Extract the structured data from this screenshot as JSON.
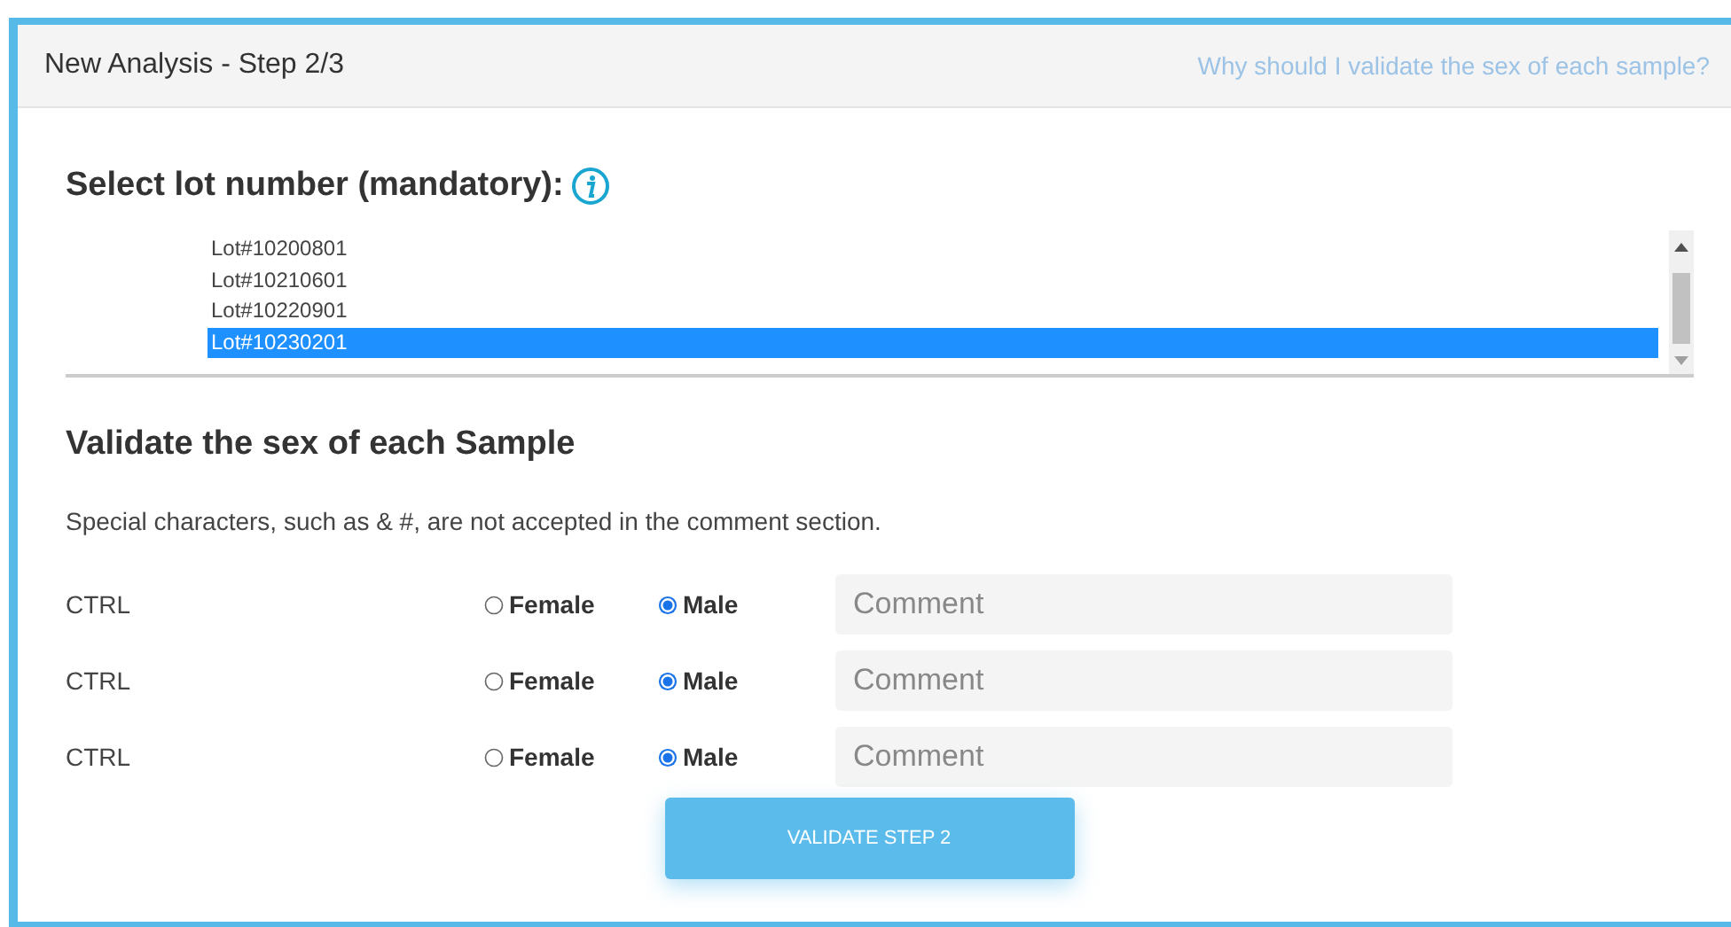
{
  "panel": {
    "title": "New Analysis - Step 2/3",
    "help_link": "Why should I validate the sex of each sample?"
  },
  "lot_section": {
    "heading": "Select lot number (mandatory):",
    "lots": [
      {
        "label": "Lot#10200801",
        "selected": false
      },
      {
        "label": "Lot#10210601",
        "selected": false
      },
      {
        "label": "Lot#10220901",
        "selected": false
      },
      {
        "label": "Lot#10230201",
        "selected": true
      }
    ]
  },
  "sex_section": {
    "heading": "Validate the sex of each Sample",
    "note": "Special characters, such as & #, are not accepted in the comment section.",
    "samples": [
      {
        "name": "CTRL",
        "options": [
          {
            "label": "Female",
            "selected": false
          },
          {
            "label": "Male",
            "selected": true
          }
        ],
        "comment_placeholder": "Comment"
      },
      {
        "name": "CTRL",
        "options": [
          {
            "label": "Female",
            "selected": false
          },
          {
            "label": "Male",
            "selected": true
          }
        ],
        "comment_placeholder": "Comment"
      },
      {
        "name": "CTRL",
        "options": [
          {
            "label": "Female",
            "selected": false
          },
          {
            "label": "Male",
            "selected": true
          }
        ],
        "comment_placeholder": "Comment"
      }
    ]
  },
  "submit_button": "VALIDATE STEP 2"
}
